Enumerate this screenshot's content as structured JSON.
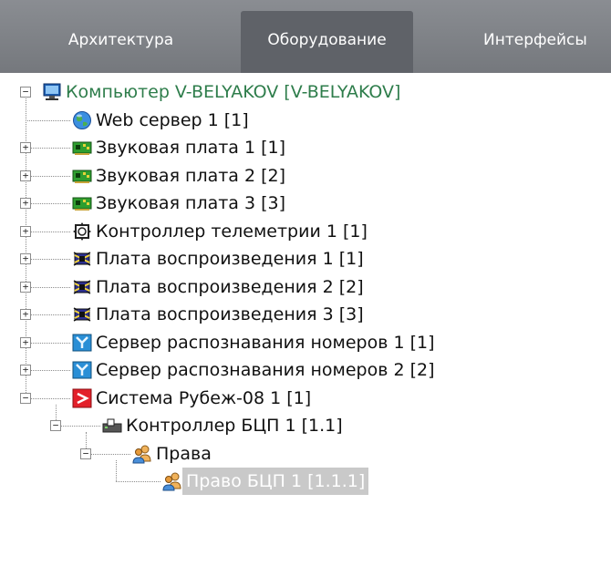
{
  "tabs": [
    {
      "label": "Архитектура",
      "active": false
    },
    {
      "label": "Оборудование",
      "active": true
    },
    {
      "label": "Интерфейсы",
      "active": false
    }
  ],
  "colors": {
    "tabbar": "#7d8085",
    "active_tab": "#5f6268",
    "root_text": "#2e7d4b",
    "selection": "#c9c9c9"
  },
  "tree": [
    {
      "label": "Компьютер V-BELYAKOV [V-BELYAKOV]",
      "icon": "computer-icon",
      "expander": "minus",
      "depth": 0,
      "kind": "root"
    },
    {
      "label": "Web сервер 1 [1]",
      "icon": "globe-icon",
      "expander": "none",
      "depth": 1,
      "kind": "item"
    },
    {
      "label": "Звуковая плата 1 [1]",
      "icon": "sound-card-icon",
      "expander": "plus",
      "depth": 1,
      "kind": "item"
    },
    {
      "label": "Звуковая плата 2 [2]",
      "icon": "sound-card-icon",
      "expander": "plus",
      "depth": 1,
      "kind": "item"
    },
    {
      "label": "Звуковая плата 3 [3]",
      "icon": "sound-card-icon",
      "expander": "plus",
      "depth": 1,
      "kind": "item"
    },
    {
      "label": "Контроллер телеметрии 1 [1]",
      "icon": "telemetry-controller-icon",
      "expander": "plus",
      "depth": 1,
      "kind": "item"
    },
    {
      "label": "Плата воспроизведения 1 [1]",
      "icon": "playback-board-icon",
      "expander": "plus",
      "depth": 1,
      "kind": "item"
    },
    {
      "label": "Плата воспроизведения 2 [2]",
      "icon": "playback-board-icon",
      "expander": "plus",
      "depth": 1,
      "kind": "item"
    },
    {
      "label": "Плата воспроизведения 3 [3]",
      "icon": "playback-board-icon",
      "expander": "plus",
      "depth": 1,
      "kind": "item"
    },
    {
      "label": "Сервер распознавания номеров 1 [1]",
      "icon": "plate-recognition-server-icon",
      "expander": "plus",
      "depth": 1,
      "kind": "item"
    },
    {
      "label": "Сервер распознавания номеров 2 [2]",
      "icon": "plate-recognition-server-icon",
      "expander": "plus",
      "depth": 1,
      "kind": "item"
    },
    {
      "label": "Система Рубеж-08 1 [1]",
      "icon": "rubezh-system-icon",
      "expander": "minus",
      "depth": 1,
      "kind": "item"
    },
    {
      "label": "Контроллер БЦП 1 [1.1]",
      "icon": "bcp-controller-icon",
      "expander": "minus",
      "depth": 2,
      "kind": "item"
    },
    {
      "label": "Права",
      "icon": "users-icon",
      "expander": "minus",
      "depth": 3,
      "kind": "item"
    },
    {
      "label": "Право БЦП 1 [1.1.1]",
      "icon": "user-right-icon",
      "expander": "none",
      "depth": 4,
      "kind": "selected"
    }
  ]
}
